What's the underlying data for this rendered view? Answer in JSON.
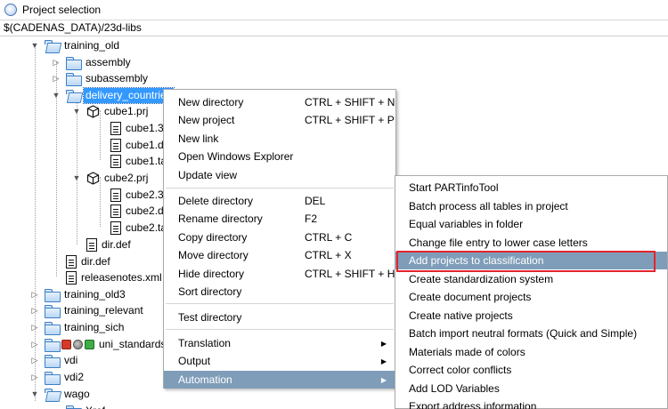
{
  "window": {
    "title": "Project selection",
    "path": "$(CADENAS_DATA)/23d-libs"
  },
  "icons": {
    "app": "globe-app-icon",
    "folder": "folder-icon",
    "document": "document-icon",
    "project": "cube-icon"
  },
  "colors": {
    "selection": "#3399ff",
    "menu_highlight": "#7f9db9",
    "callout": "#e3242b",
    "folder": "#3c7fc7"
  },
  "tree": [
    {
      "label": "training_old",
      "icon": "folder-open",
      "toggle": "expanded"
    },
    {
      "label": "assembly",
      "icon": "folder",
      "toggle": "collapsed"
    },
    {
      "label": "subassembly",
      "icon": "folder",
      "toggle": "collapsed"
    },
    {
      "label": "delivery_countries",
      "icon": "folder-open",
      "toggle": "expanded",
      "selected": true
    },
    {
      "label": "cube1.prj",
      "icon": "cube",
      "toggle": "expanded"
    },
    {
      "label": "cube1.3",
      "icon": "document"
    },
    {
      "label": "cube1.d",
      "icon": "document"
    },
    {
      "label": "cube1.ta",
      "icon": "document"
    },
    {
      "label": "cube2.prj",
      "icon": "cube",
      "toggle": "expanded"
    },
    {
      "label": "cube2.3",
      "icon": "document"
    },
    {
      "label": "cube2.d",
      "icon": "document"
    },
    {
      "label": "cube2.ta",
      "icon": "document"
    },
    {
      "label": "dir.def",
      "icon": "document"
    },
    {
      "label": "dir.def",
      "icon": "document"
    },
    {
      "label": "releasenotes.xml",
      "icon": "document"
    },
    {
      "label": "training_old3",
      "icon": "folder",
      "toggle": "collapsed"
    },
    {
      "label": "training_relevant",
      "icon": "folder",
      "toggle": "collapsed"
    },
    {
      "label": "training_sich",
      "icon": "folder",
      "toggle": "collapsed"
    },
    {
      "label": "uni_standards",
      "icon": "folder",
      "toggle": "collapsed"
    },
    {
      "label": "vdi",
      "icon": "folder",
      "toggle": "collapsed"
    },
    {
      "label": "vdi2",
      "icon": "folder",
      "toggle": "collapsed"
    },
    {
      "label": "wago",
      "icon": "folder-open",
      "toggle": "expanded"
    },
    {
      "label": "Xref",
      "icon": "folder"
    }
  ],
  "context_menu": [
    {
      "label": "New directory",
      "shortcut": "CTRL + SHIFT + N"
    },
    {
      "label": "New project",
      "shortcut": "CTRL + SHIFT + P"
    },
    {
      "label": "New link",
      "shortcut": ""
    },
    {
      "label": "Open Windows Explorer",
      "shortcut": ""
    },
    {
      "label": "Update view",
      "shortcut": ""
    },
    {
      "label": "Delete directory",
      "shortcut": "DEL"
    },
    {
      "label": "Rename directory",
      "shortcut": "F2"
    },
    {
      "label": "Copy directory",
      "shortcut": "CTRL + C"
    },
    {
      "label": "Move directory",
      "shortcut": "CTRL + X"
    },
    {
      "label": "Hide directory",
      "shortcut": "CTRL + SHIFT + H"
    },
    {
      "label": "Sort directory",
      "shortcut": ""
    },
    {
      "label": "Test directory",
      "shortcut": ""
    },
    {
      "label": "Translation",
      "shortcut": "",
      "submenu": true
    },
    {
      "label": "Output",
      "shortcut": "",
      "submenu": true
    },
    {
      "label": "Automation",
      "shortcut": "",
      "submenu": true,
      "highlighted": true
    }
  ],
  "automation_submenu": [
    {
      "label": "Start PARTinfoTool"
    },
    {
      "label": "Batch process all tables in project"
    },
    {
      "label": "Equal variables in folder"
    },
    {
      "label": "Change file entry to lower case letters"
    },
    {
      "label": "Add projects to classification",
      "highlighted": true,
      "callout": true
    },
    {
      "label": "Create standardization system"
    },
    {
      "label": "Create document projects"
    },
    {
      "label": "Create native projects"
    },
    {
      "label": "Batch import neutral formats (Quick and Simple)"
    },
    {
      "label": "Materials made of colors"
    },
    {
      "label": "Correct color conflicts"
    },
    {
      "label": "Add LOD Variables"
    },
    {
      "label": "Export address information"
    }
  ]
}
